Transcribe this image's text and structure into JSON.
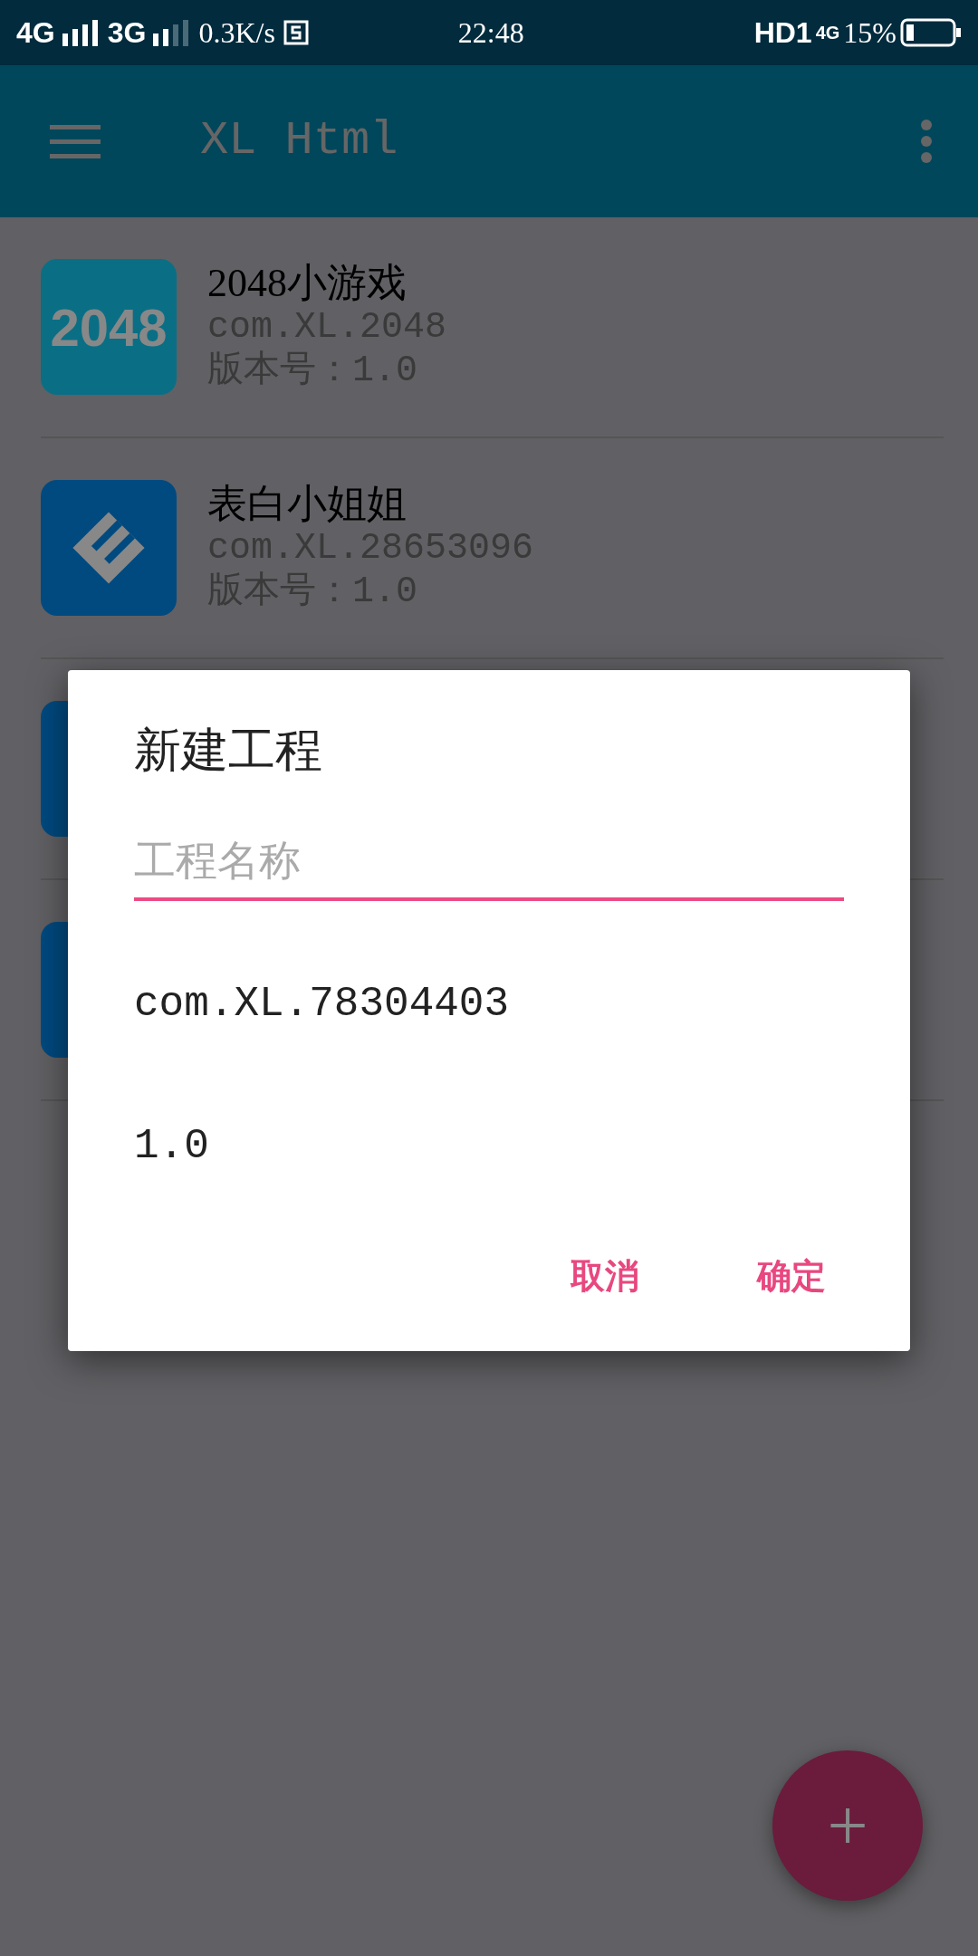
{
  "status_bar": {
    "network_1": "4G",
    "network_2": "3G",
    "speed": "0.3K/s",
    "time": "22:48",
    "hd": "HD1",
    "network_3": "4G",
    "battery": "15%"
  },
  "app_bar": {
    "title": "XL Html"
  },
  "projects": [
    {
      "kind": "number-tile",
      "icon_text": "2048",
      "title": "2048小游戏",
      "package": "com.XL.2048",
      "version": "版本号：1.0"
    },
    {
      "kind": "emblem",
      "title": "表白小姐姐",
      "package": "com.XL.28653096",
      "version": "版本号：1.0"
    },
    {
      "kind": "plain"
    },
    {
      "kind": "plain"
    }
  ],
  "dialog": {
    "title": "新建工程",
    "name_field": {
      "placeholder": "工程名称",
      "focused": true
    },
    "package": "com.XL.78304403",
    "version": "1.0",
    "buttons": [
      "取消",
      "确定"
    ]
  },
  "fab": {
    "label": "+"
  }
}
